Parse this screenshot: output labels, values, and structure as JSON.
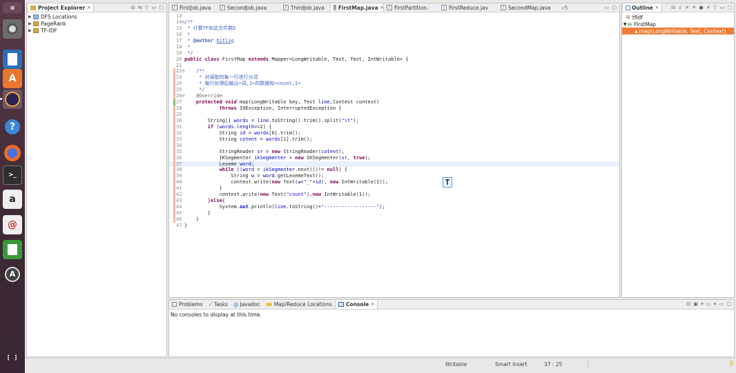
{
  "project_explorer": {
    "title": "Project Explorer",
    "items": [
      {
        "label": "DFS Locations",
        "icon": "dfs-icon"
      },
      {
        "label": "PageRank",
        "icon": "project-folder-icon"
      },
      {
        "label": "TF-IDF",
        "icon": "project-folder-icon"
      }
    ]
  },
  "editor_tabs": [
    {
      "label": "FirstJob.java",
      "active": false
    },
    {
      "label": "SecondJob.java",
      "active": false
    },
    {
      "label": "ThirdJob.java",
      "active": false
    },
    {
      "label": "FirstMap.java",
      "active": true
    },
    {
      "label": "FirstPartition.",
      "active": false
    },
    {
      "label": "FirstReduce.jav",
      "active": false
    },
    {
      "label": "SecondMap.java",
      "active": false
    }
  ],
  "editor_overflow": "»5",
  "code_lines": [
    {
      "n": "13",
      "html": ""
    },
    {
      "n": "14⊖",
      "html": "<span class='cm'>/**</span>"
    },
    {
      "n": "15",
      "html": "<span class='cm'> * 计算TF和总文件数D</span>"
    },
    {
      "n": "16",
      "html": "<span class='cm'> *</span>"
    },
    {
      "n": "17",
      "html": "<span class='cm'> * <b>@author</b> <span class='uline'>hitlsg</span></span>"
    },
    {
      "n": "18",
      "html": "<span class='cm'> *</span>"
    },
    {
      "n": "19",
      "html": "<span class='cm'> */</span>"
    },
    {
      "n": "20",
      "html": "<span class='kw'>public class</span> FirstMap <span class='kw'>extends</span> Mapper&lt;LongWritable, Text, Text, IntWritable&gt; {"
    },
    {
      "n": "21",
      "html": ""
    },
    {
      "n": "22⊖",
      "html": "    <span class='cm'>/**</span>",
      "gutter": "r"
    },
    {
      "n": "23",
      "html": "<span class='cm'>     * 对读取的每一行进行分词</span>",
      "gutter": "r"
    },
    {
      "n": "24",
      "html": "<span class='cm'>     * 每行处理后输出&lt;词,1&gt;的数据和&lt;count,1&gt;</span>",
      "gutter": "r"
    },
    {
      "n": "25",
      "html": "<span class='cm'>     */</span>",
      "gutter": "r"
    },
    {
      "n": "26⊖",
      "html": "    <span class='ann'>@Override</span>",
      "gutter": "r"
    },
    {
      "n": "27",
      "html": "    <span class='kw'>protected void</span> map(LongWritable key, Text <span class='var'>line</span>,Context context)",
      "gutter": "g"
    },
    {
      "n": "28",
      "html": "            <span class='kw'>throws</span> IOException, InterruptedException {",
      "gutter": "r"
    },
    {
      "n": "29",
      "html": "",
      "gutter": "r"
    },
    {
      "n": "30",
      "html": "        String[] <span class='var'>words</span> = <span class='var'>line</span>.toString().trim().split(<span class='str'>\"\\t\"</span>);",
      "gutter": "r"
    },
    {
      "n": "31",
      "html": "        <span class='kw'>if</span> (<span class='var'>words</span>.<span class='var'>length</span>&gt;=2) {",
      "gutter": "r"
    },
    {
      "n": "32",
      "html": "            String <span class='var'>id</span> = <span class='var'>words</span>[0].trim();",
      "gutter": "r"
    },
    {
      "n": "33",
      "html": "            String <span class='var'>cotent</span> = <span class='var'>words</span>[1].trim();",
      "gutter": "r"
    },
    {
      "n": "34",
      "html": "",
      "gutter": "r"
    },
    {
      "n": "35",
      "html": "            StringReader <span class='var'>sr</span> = <span class='kw'>new</span> StringReader(<span class='var'>cotent</span>);",
      "gutter": "r"
    },
    {
      "n": "36",
      "html": "            IKSegmenter <span class='var'>ikSegmenter</span> = <span class='kw'>new</span> IKSegmenter(<span class='var'>sr</span>, <span class='kw'>true</span>);",
      "gutter": "r"
    },
    {
      "n": "37",
      "html": "            Lexeme <span class='var'>word</span>;",
      "gutter": "r",
      "highlight": true
    },
    {
      "n": "38",
      "html": "            <span class='kw'>while</span> ((<span class='var'>word</span> = <span class='var'>ikSegmenter</span>.next())!= <span class='kw'>null</span>) {",
      "gutter": "r"
    },
    {
      "n": "39",
      "html": "                String <span class='var'>w</span> = <span class='var'>word</span>.getLexemeText();",
      "gutter": "r"
    },
    {
      "n": "40",
      "html": "                context.write(<span class='kw'>new</span> Text(<span class='var'>w</span>+<span class='str'>\"_\"</span>+<span class='var'>id</span>), <span class='kw'>new</span> IntWritable(1));",
      "gutter": "r"
    },
    {
      "n": "41",
      "html": "            }",
      "gutter": "r"
    },
    {
      "n": "42",
      "html": "            context.write(<span class='kw'>new</span> Text(<span class='str'>\"count\"</span>),<span class='kw'>new</span> IntWritable(1));",
      "gutter": "r"
    },
    {
      "n": "43",
      "html": "        }<span class='kw'>else</span>{",
      "gutter": "r"
    },
    {
      "n": "44",
      "html": "            System.<span class='ital'>out</span>.println(<span class='var'>line</span>.toString()+<span class='str'>\"------------------\"</span>);",
      "gutter": "r"
    },
    {
      "n": "45",
      "html": "        }",
      "gutter": "r"
    },
    {
      "n": "46",
      "html": "    }",
      "gutter": "r"
    },
    {
      "n": "47",
      "html": "}"
    }
  ],
  "outline": {
    "title": "Outline",
    "items": [
      {
        "label": "tfidf",
        "icon": "package-icon",
        "indent": 0
      },
      {
        "label": "FirstMap",
        "icon": "class-icon",
        "indent": 0
      },
      {
        "label": "map(LongWritable, Text, Context)",
        "icon": "method-icon",
        "indent": 1,
        "selected": true
      }
    ]
  },
  "bottom_tabs": [
    {
      "label": "Problems",
      "icon": "problems-icon"
    },
    {
      "label": "Tasks",
      "icon": "tasks-icon"
    },
    {
      "label": "Javadoc",
      "icon": "javadoc-icon"
    },
    {
      "label": "Map/Reduce Locations",
      "icon": "mapreduce-icon"
    },
    {
      "label": "Console",
      "icon": "console-icon",
      "active": true
    }
  ],
  "console_message": "No consoles to display at this time.",
  "status": {
    "writable": "Writable",
    "insert_mode": "Smart Insert",
    "position": "37 : 25"
  },
  "colors": {
    "selection": "#f07c35",
    "keyword": "#7f0055",
    "comment": "#3f5fbf",
    "string": "#2a00ff"
  }
}
